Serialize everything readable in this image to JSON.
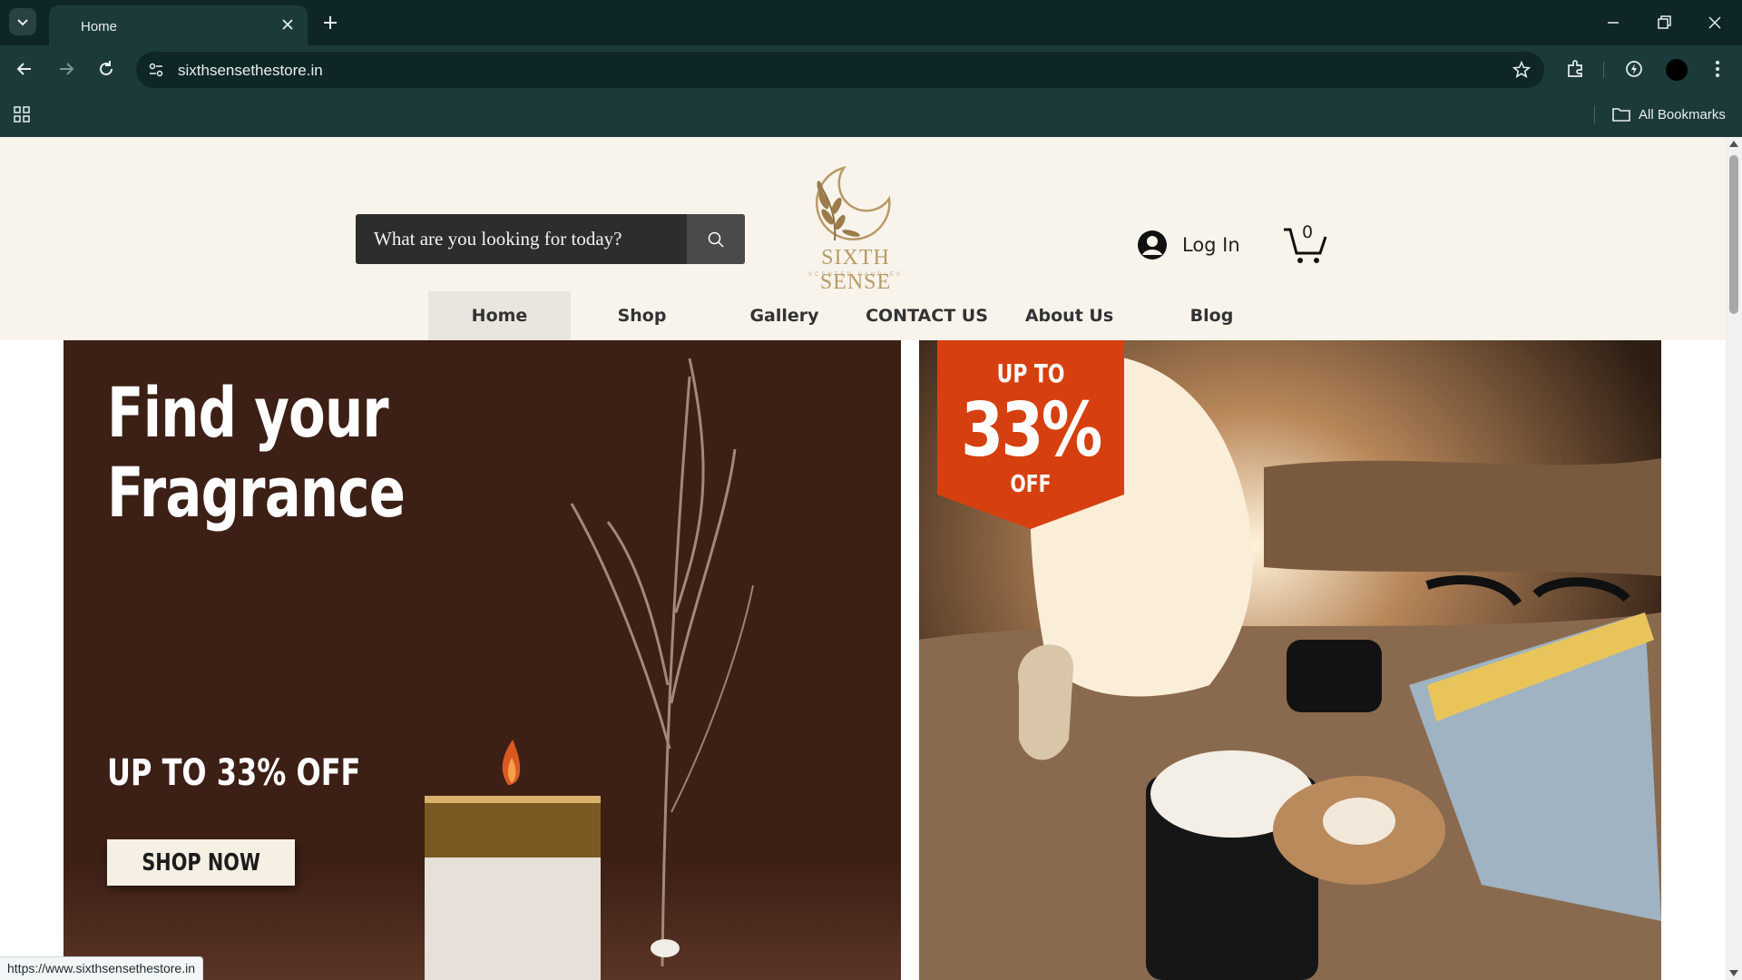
{
  "browser": {
    "tab_title": "Home",
    "url": "sixthsensethestore.in",
    "bookmarks_label": "All Bookmarks",
    "status_url": "https://www.sixthsensethestore.in"
  },
  "site": {
    "search_placeholder": "What are you looking for today?",
    "logo_text": "SIXTH SENSE",
    "logo_subtext": "SCENTED CANDLES",
    "login_label": "Log In",
    "cart_count": "0",
    "nav": [
      {
        "label": "Home",
        "active": true
      },
      {
        "label": "Shop"
      },
      {
        "label": "Gallery"
      },
      {
        "label": "CONTACT US"
      },
      {
        "label": "About Us"
      },
      {
        "label": "Blog"
      }
    ]
  },
  "hero": {
    "title_line1": "Find your",
    "title_line2": "Fragrance",
    "subtitle": "UP TO 33% OFF",
    "cta": "SHOP NOW",
    "promo_up": "UP TO",
    "promo_pct": "33%",
    "promo_off": "OFF"
  },
  "colors": {
    "chrome_dark": "#0f2626",
    "chrome": "#1c3a3a",
    "header_bg": "#f8f4ec",
    "hero_left_bg": "#3c1f15",
    "promo_orange": "#d64010",
    "logo_gold": "#b89a68"
  }
}
